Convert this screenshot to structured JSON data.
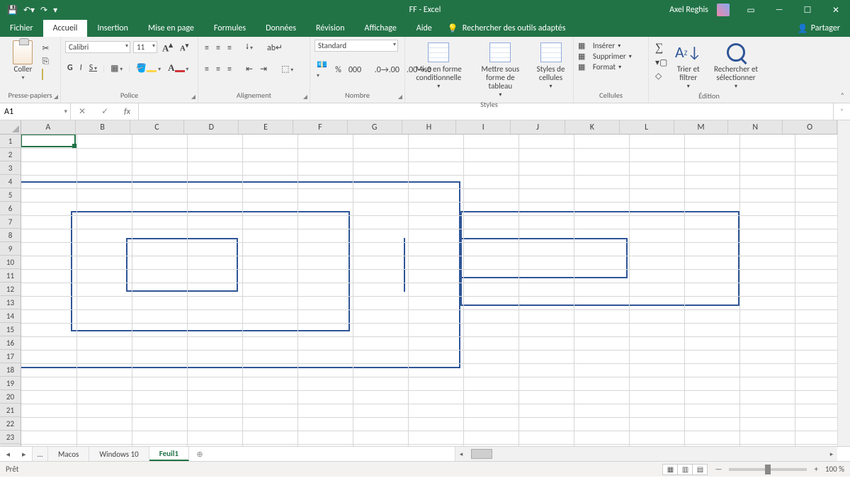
{
  "titlebar": {
    "doc_title": "FF  -  Excel",
    "user": "Axel Reghis"
  },
  "tabs": {
    "items": [
      "Fichier",
      "Accueil",
      "Insertion",
      "Mise en page",
      "Formules",
      "Données",
      "Révision",
      "Affichage",
      "Aide"
    ],
    "active_index": 1,
    "tell_me": "Rechercher des outils adaptés",
    "share": "Partager"
  },
  "ribbon": {
    "clipboard": {
      "paste": "Coller",
      "label": "Presse-papiers"
    },
    "font": {
      "name": "Calibri",
      "size": "11",
      "bold": "G",
      "italic": "I",
      "underline": "S",
      "label": "Police"
    },
    "alignment": {
      "wrap": "",
      "merge": "",
      "label": "Alignement"
    },
    "number": {
      "format": "Standard",
      "label": "Nombre"
    },
    "styles": {
      "cond": "Mise en forme conditionnelle",
      "table": "Mettre sous forme de tableau",
      "cell": "Styles de cellules",
      "label": "Styles"
    },
    "cells": {
      "insert": "Insérer",
      "delete": "Supprimer",
      "format": "Format",
      "label": "Cellules"
    },
    "editing": {
      "sort": "Trier et filtrer",
      "find": "Rechercher et sélectionner",
      "label": "Édition"
    }
  },
  "formula_bar": {
    "name_box": "A1",
    "fx": "fx",
    "value": ""
  },
  "grid": {
    "columns": [
      "A",
      "B",
      "C",
      "D",
      "E",
      "F",
      "G",
      "H",
      "I",
      "J",
      "K",
      "L",
      "M",
      "N",
      "O"
    ],
    "row_count": 23,
    "active_cell": "A1"
  },
  "sheet_tabs": {
    "items": [
      "Macos",
      "Windows 10",
      "Feuil1"
    ],
    "active_index": 2,
    "ellipsis": "..."
  },
  "status": {
    "ready": "Prêt",
    "zoom": "100 %"
  }
}
